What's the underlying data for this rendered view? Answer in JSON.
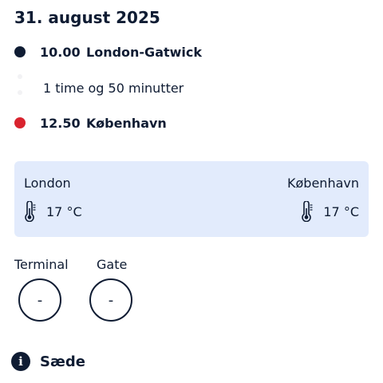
{
  "flight": {
    "date": "31. august 2025",
    "departure": {
      "time": "10.00",
      "place": "London-Gatwick"
    },
    "duration": "1 time og 50 minutter",
    "arrival": {
      "time": "12.50",
      "place": "København"
    }
  },
  "weather": {
    "origin": {
      "city": "London",
      "temp": "17 °C"
    },
    "destination": {
      "city": "København",
      "temp": "17 °C"
    }
  },
  "airport_info": {
    "terminal_label": "Terminal",
    "terminal_value": "-",
    "gate_label": "Gate",
    "gate_value": "-"
  },
  "seat": {
    "label": "Sæde",
    "icon_glyph": "i"
  },
  "colors": {
    "navy": "#0f1c33",
    "red": "#d9232e",
    "card_bg": "#e2ebfc"
  }
}
